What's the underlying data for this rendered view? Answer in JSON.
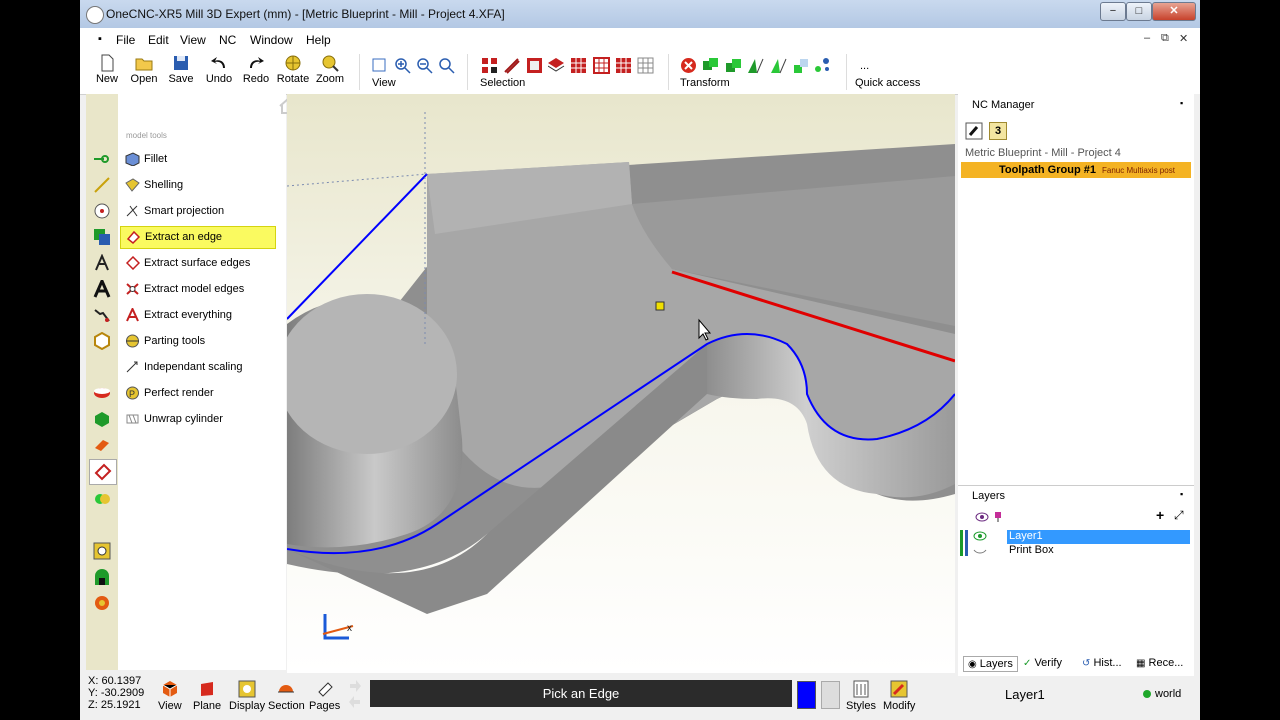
{
  "window": {
    "title": "OneCNC-XR5 Mill 3D Expert (mm) - [Metric Blueprint - Mill - Project 4.XFA]",
    "min": "−",
    "max": "□",
    "close": "✕"
  },
  "menu": {
    "items": [
      "File",
      "Edit",
      "View",
      "NC",
      "Window",
      "Help"
    ],
    "sys": "▪",
    "mdi_min": "–",
    "mdi_max": "⧉",
    "mdi_close": "✕"
  },
  "toolbar": {
    "buttons": [
      "New",
      "Open",
      "Save",
      "Undo",
      "Redo",
      "Rotate",
      "Zoom"
    ],
    "view_label": "View",
    "selection_label": "Selection",
    "transform_label": "Transform",
    "quick_access_label": "Quick access",
    "ellipsis": "..."
  },
  "tools": {
    "header": "model tools",
    "items": [
      "Fillet",
      "Shelling",
      "Smart projection",
      "Extract an edge",
      "Extract surface edges",
      "Extract model edges",
      "Extract everything",
      "Parting tools",
      "Independant scaling",
      "Perfect render",
      "Unwrap cylinder"
    ],
    "selected": "Extract an edge"
  },
  "viewport": {
    "axis_label": "x"
  },
  "nc_manager": {
    "title": "NC Manager",
    "badge": "3",
    "root": "Metric Blueprint - Mill - Project 4",
    "group_label": "Toolpath Group #1",
    "group_post": "Fanuc Multiaxis post",
    "pin": "▪"
  },
  "layers": {
    "title": "Layers",
    "plus": "+",
    "expand": "⤢",
    "rows": [
      "Layer1",
      "Print Box"
    ],
    "selected": "Layer1"
  },
  "tabs": [
    "Layers",
    "Verify",
    "Hist...",
    "Rece..."
  ],
  "status": {
    "x": "X: 60.1397",
    "y": "Y: -30.2909",
    "z": "Z: 25.1921",
    "buttons": [
      "View",
      "Plane",
      "Display",
      "Section",
      "Pages"
    ],
    "prompt": "Pick an Edge",
    "right_buttons": [
      "Styles",
      "Modify"
    ],
    "current_layer": "Layer1",
    "world": "world"
  },
  "colors": {
    "accent_blue": "#0000ff",
    "edge_red": "#e00000",
    "selected_yellow": "#fafa60",
    "group_orange": "#f4b324",
    "layer_select": "#3399ff"
  }
}
